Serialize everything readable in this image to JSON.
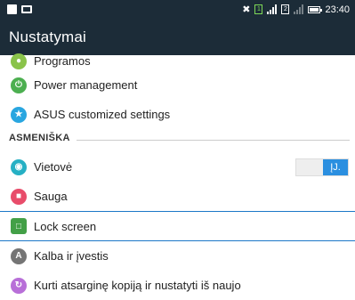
{
  "status_bar": {
    "time": "23:40",
    "sim_labels": [
      "1",
      "2"
    ]
  },
  "app_bar": {
    "title": "Nustatymai"
  },
  "section": {
    "title": "ASMENIŠKA"
  },
  "items": [
    {
      "label": "Programos",
      "icon": "apps-icon",
      "color": "#8ac34a"
    },
    {
      "label": "Power management",
      "icon": "power-icon",
      "color": "#4caf50"
    },
    {
      "label": "ASUS customized settings",
      "icon": "asus-icon",
      "color": "#29a6e0"
    },
    {
      "label": "Vietovė",
      "icon": "location-icon",
      "color": "#26b0c4",
      "toggle": "ĮJ."
    },
    {
      "label": "Sauga",
      "icon": "lock-icon",
      "color": "#e84c6a"
    },
    {
      "label": "Lock screen",
      "icon": "lock-screen-icon",
      "color": "#43a047"
    },
    {
      "label": "Kalba ir įvestis",
      "icon": "language-icon",
      "color": "#757575"
    },
    {
      "label": "Kurti atsarginę kopiją ir nustatyti iš naujo",
      "icon": "backup-icon",
      "color": "#b86fd8"
    }
  ]
}
